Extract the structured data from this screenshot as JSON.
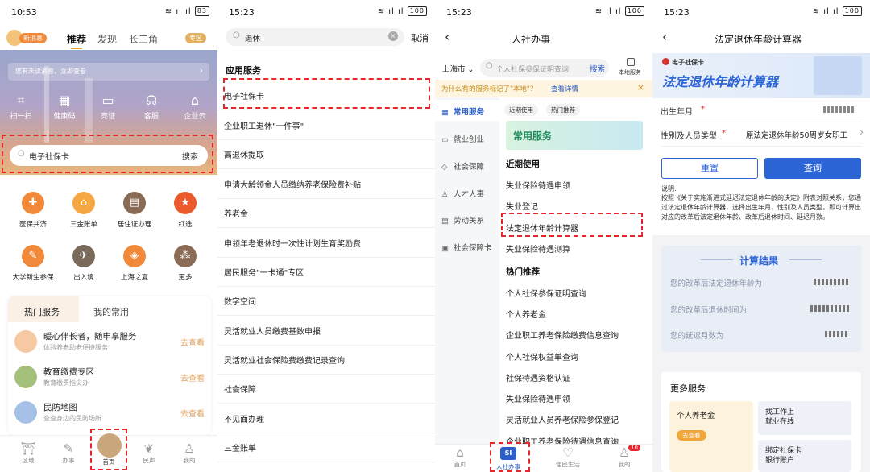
{
  "s1": {
    "status": {
      "time": "10:53",
      "battery": "83"
    },
    "new_msg": "新消息",
    "tabs": [
      "推荐",
      "发现",
      "长三角"
    ],
    "area": "专区",
    "notice": "您有未读消息，立即查看",
    "features": [
      "扫一扫",
      "健康码",
      "亮证",
      "客服",
      "企业云"
    ],
    "search": {
      "text": "电子社保卡",
      "button": "搜索"
    },
    "services": [
      "医保共济",
      "三金账单",
      "居住证办理",
      "红途",
      "大学新生参保",
      "出入境",
      "上海之夏",
      "更多"
    ],
    "hot_tabs": [
      "热门服务",
      "我的常用"
    ],
    "hot": [
      {
        "title": "暖心伴长者，随申享服务",
        "sub": "体验养老助老便捷服务",
        "go": "去查看"
      },
      {
        "title": "教育缴费专区",
        "sub": "教育缴费指尖办",
        "go": "去查看"
      },
      {
        "title": "民防地图",
        "sub": "查查身边的民防场所",
        "go": "去查看"
      }
    ],
    "nav": [
      "区域",
      "办事",
      "首页",
      "民声",
      "我的"
    ]
  },
  "s2": {
    "status": {
      "time": "15:23",
      "battery": "100"
    },
    "search": {
      "text": "退休",
      "cancel": "取消"
    },
    "section": "应用服务",
    "items": [
      "电子社保卡",
      "企业职工退休\"一件事\"",
      "离退休提取",
      "申请大龄领金人员缴纳养老保险费补贴",
      "养老金",
      "申领年老退休时一次性计划生育奖励费",
      "居民服务\"一卡通\"专区",
      "数字空间",
      "灵活就业人员缴费基数申报",
      "灵活就业社会保险费缴费记录查询",
      "社会保障",
      "不见面办理",
      "三金账单"
    ]
  },
  "s3": {
    "status": {
      "time": "15:23",
      "battery": "100"
    },
    "title": "人社办事",
    "city": "上海市 ⌄",
    "search": {
      "placeholder": "个人社保参保证明查询",
      "button": "搜索",
      "local": "本地服务"
    },
    "notice": "为什么有的服务标记了\"本地\"？",
    "notice_link": "查看详情",
    "sidebar": [
      "常用服务",
      "就业创业",
      "社会保障",
      "人才人事",
      "劳动关系",
      "社会保障卡"
    ],
    "chips": [
      "近期使用",
      "热门推荐"
    ],
    "banner": "常用服务",
    "recent_title": "近期使用",
    "recent": [
      "失业保险待遇申领",
      "失业登记",
      "法定退休年龄计算器",
      "失业保险待遇测算"
    ],
    "hot_title": "热门推荐",
    "hot": [
      "个人社保参保证明查询",
      "个人养老金",
      "企业职工养老保险缴费信息查询",
      "个人社保权益单查询",
      "社保待遇资格认证",
      "失业保险待遇申领",
      "灵活就业人员养老保险参保登记",
      "企业职工养老保险待遇信息查询"
    ],
    "nav": [
      "首页",
      "人社办事",
      "便民生活",
      "我的"
    ],
    "badge": "10"
  },
  "s4": {
    "status": {
      "time": "15:23",
      "battery": "100"
    },
    "title": "法定退休年龄计算器",
    "brand": "电子社保卡",
    "banner_title": "法定退休年龄计算器",
    "birth_label": "出生年月",
    "type_label": "性别及人员类型",
    "type_value": "原法定退休年龄50周岁女职工",
    "reset": "重置",
    "query": "查询",
    "note_title": "说明:",
    "note": "按照《关于实施渐进式延迟法定退休年龄的决定》附表对照关系，您通过法定退休年龄计算器，选择出生年月、性别及人员类型，即可计算出对应的改革后法定退休年龄、改革后退休时间、延迟月数。",
    "result_title": "计算结果",
    "results": [
      "您的改革后法定退休年龄为",
      "您的改革后退休时间为",
      "您的延迟月数为"
    ],
    "more": "更多服务",
    "more_items": [
      {
        "t": "个人养老金",
        "b": "去查看"
      },
      {
        "t": "找工作上\n就业在线"
      },
      {
        "t": "绑定社保卡\n银行账户"
      }
    ]
  }
}
